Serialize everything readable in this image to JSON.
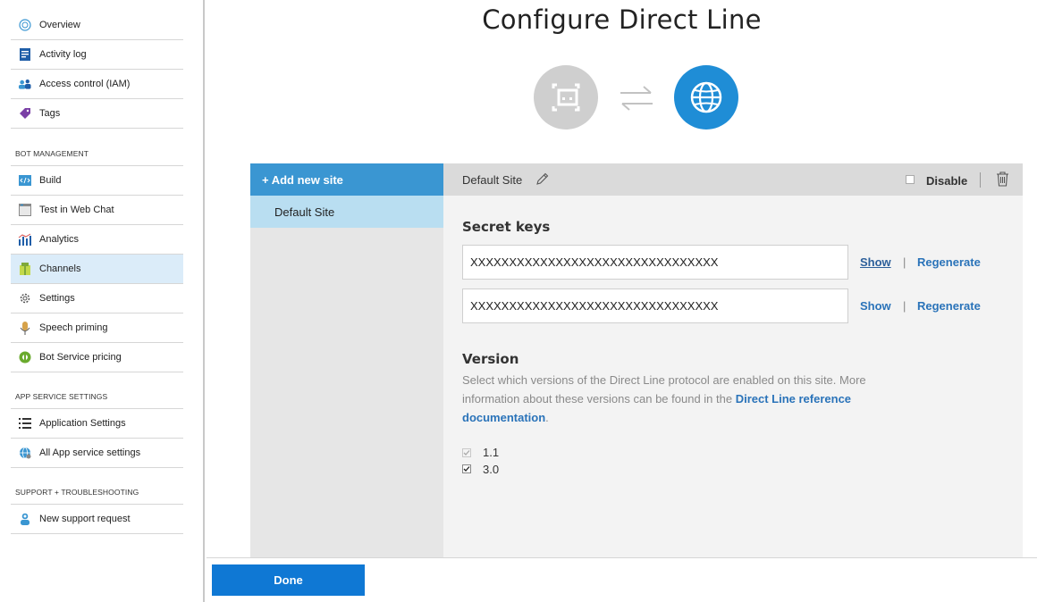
{
  "sidebar": {
    "items_top": [
      {
        "label": "Overview",
        "icon": "overview-icon"
      },
      {
        "label": "Activity log",
        "icon": "activity-log-icon"
      },
      {
        "label": "Access control (IAM)",
        "icon": "access-control-icon"
      },
      {
        "label": "Tags",
        "icon": "tag-icon"
      }
    ],
    "bot_management_title": "BOT MANAGEMENT",
    "bot_management_items": [
      {
        "label": "Build",
        "icon": "code-icon"
      },
      {
        "label": "Test in Web Chat",
        "icon": "web-chat-icon"
      },
      {
        "label": "Analytics",
        "icon": "analytics-icon"
      },
      {
        "label": "Channels",
        "icon": "channels-icon",
        "active": true
      },
      {
        "label": "Settings",
        "icon": "gear-icon"
      },
      {
        "label": "Speech priming",
        "icon": "speech-priming-icon"
      },
      {
        "label": "Bot Service pricing",
        "icon": "pricing-icon"
      }
    ],
    "app_service_title": "APP SERVICE SETTINGS",
    "app_service_items": [
      {
        "label": "Application Settings",
        "icon": "list-icon"
      },
      {
        "label": "All App service settings",
        "icon": "globe-gear-icon"
      }
    ],
    "support_title": "SUPPORT + TROUBLESHOOTING",
    "support_items": [
      {
        "label": "New support request",
        "icon": "support-person-icon"
      }
    ]
  },
  "main": {
    "title": "Configure Direct Line",
    "icons": {
      "left": "bot-icon",
      "middle": "swap-arrows-icon",
      "right": "globe-icon"
    },
    "colors": {
      "accent": "#1f8dd6",
      "sidebar_active": "#dbecf9",
      "done_button": "#0f78d4"
    }
  },
  "sites": {
    "add_label": "+ Add new site",
    "items": [
      "Default Site"
    ]
  },
  "site_detail": {
    "name": "Default Site",
    "disable_label": "Disable",
    "disabled": false,
    "secret_keys_title": "Secret keys",
    "keys": [
      {
        "value": "XXXXXXXXXXXXXXXXXXXXXXXXXXXXXXXX",
        "show_label": "Show",
        "regen_label": "Regenerate"
      },
      {
        "value": "XXXXXXXXXXXXXXXXXXXXXXXXXXXXXXXX",
        "show_label": "Show",
        "regen_label": "Regenerate"
      }
    ],
    "key_separator": "|",
    "version_title": "Version",
    "version_desc_1": "Select which versions of the Direct Line protocol are enabled on this site. More information about these versions can be found in the ",
    "version_link": "Direct Line reference documentation",
    "version_desc_2": ".",
    "versions": [
      {
        "label": "1.1",
        "checked": true,
        "disabled": true
      },
      {
        "label": "3.0",
        "checked": true,
        "disabled": false
      }
    ]
  },
  "footer": {
    "done_label": "Done"
  }
}
